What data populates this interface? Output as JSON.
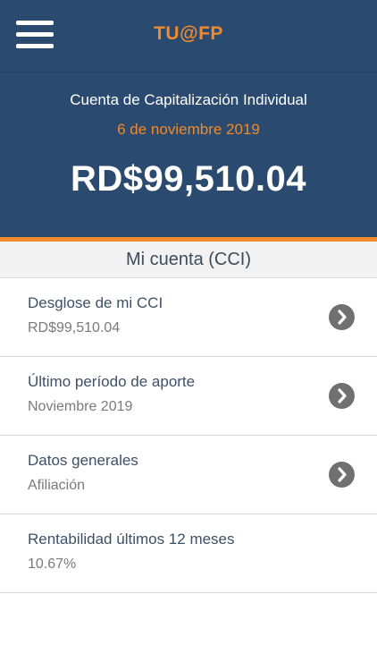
{
  "header": {
    "app_title": "TU@FP",
    "account_type": "Cuenta de Capitalización Individual",
    "date": "6 de noviembre 2019",
    "balance": "RD$99,510.04",
    "menu_icon": "hamburger-menu-icon"
  },
  "colors": {
    "header_bg": "#2b4a6f",
    "accent": "#f08a2c",
    "section_bg": "#f2f2f2",
    "chevron_bg": "#707070"
  },
  "section": {
    "title": "Mi cuenta (CCI)"
  },
  "items": [
    {
      "title": "Desglose de mi CCI",
      "value": "RD$99,510.04",
      "icon": "chevron-right-circle-icon"
    },
    {
      "title": "Último período de aporte",
      "value": "Noviembre 2019",
      "icon": "chevron-right-circle-icon"
    },
    {
      "title": "Datos generales",
      "value": "Afiliación",
      "icon": "chevron-right-circle-icon"
    },
    {
      "title": "Rentabilidad últimos 12 meses",
      "value": "10.67%"
    }
  ]
}
